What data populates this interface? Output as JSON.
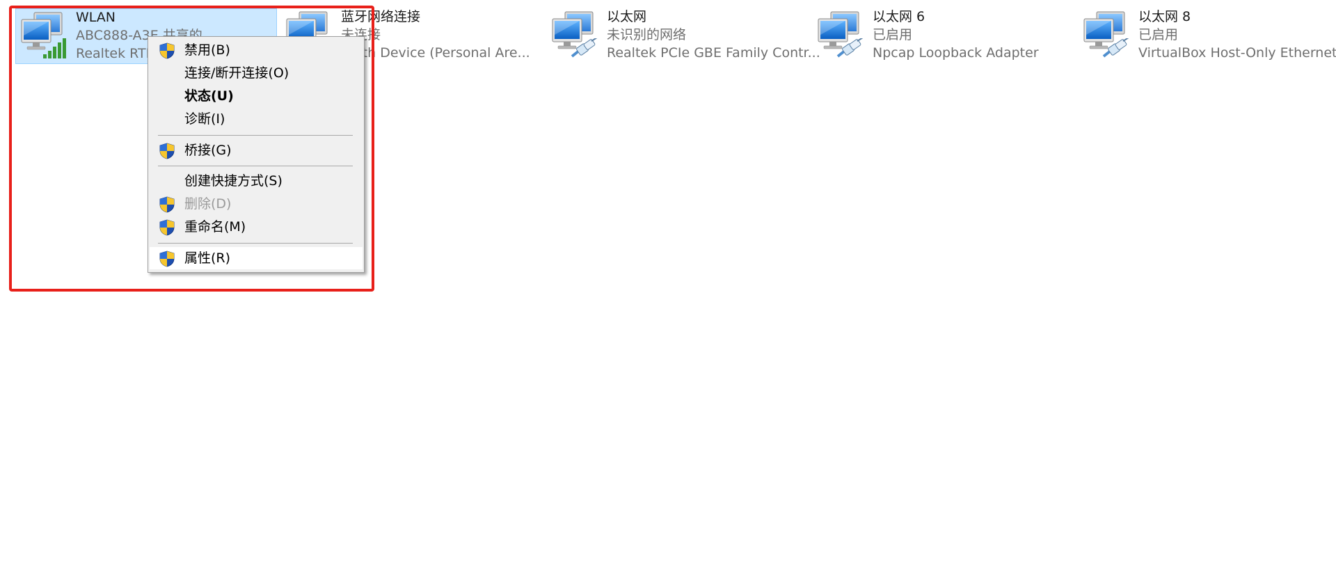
{
  "adapters": [
    {
      "name": "WLAN",
      "status": "ABC888-A3E 共享的",
      "device": "Realtek RTL8"
    },
    {
      "name": "蓝牙网络连接",
      "status": "未连接",
      "device": "tooth Device (Personal Are..."
    },
    {
      "name": "以太网",
      "status": "未识别的网络",
      "device": "Realtek PCIe GBE Family Contr..."
    },
    {
      "name": "以太网 6",
      "status": "已启用",
      "device": "Npcap Loopback Adapter"
    },
    {
      "name": "以太网 8",
      "status": "已启用",
      "device": "VirtualBox Host-Only Ethernet ..."
    }
  ],
  "context_menu": {
    "items": [
      {
        "label": "禁用(B)",
        "shield": true
      },
      {
        "label": "连接/断开连接(O)",
        "shield": false
      },
      {
        "label": "状态(U)",
        "shield": false,
        "bold": true
      },
      {
        "label": "诊断(I)",
        "shield": false
      },
      {
        "label": "桥接(G)",
        "shield": true
      },
      {
        "label": "创建快捷方式(S)",
        "shield": false
      },
      {
        "label": "删除(D)",
        "shield": true,
        "disabled": true
      },
      {
        "label": "重命名(M)",
        "shield": true
      },
      {
        "label": "属性(R)",
        "shield": true,
        "hover": true
      }
    ]
  },
  "icons": {
    "adapter": "network-adapter-icon",
    "wifi_signal": "wifi-signal-bars-icon",
    "cable": "ethernet-cable-icon",
    "shield": "uac-shield-icon"
  },
  "colors": {
    "selection_bg": "#cce8ff",
    "highlight_border": "#e8201a",
    "menu_bg": "#f0f0f0"
  }
}
